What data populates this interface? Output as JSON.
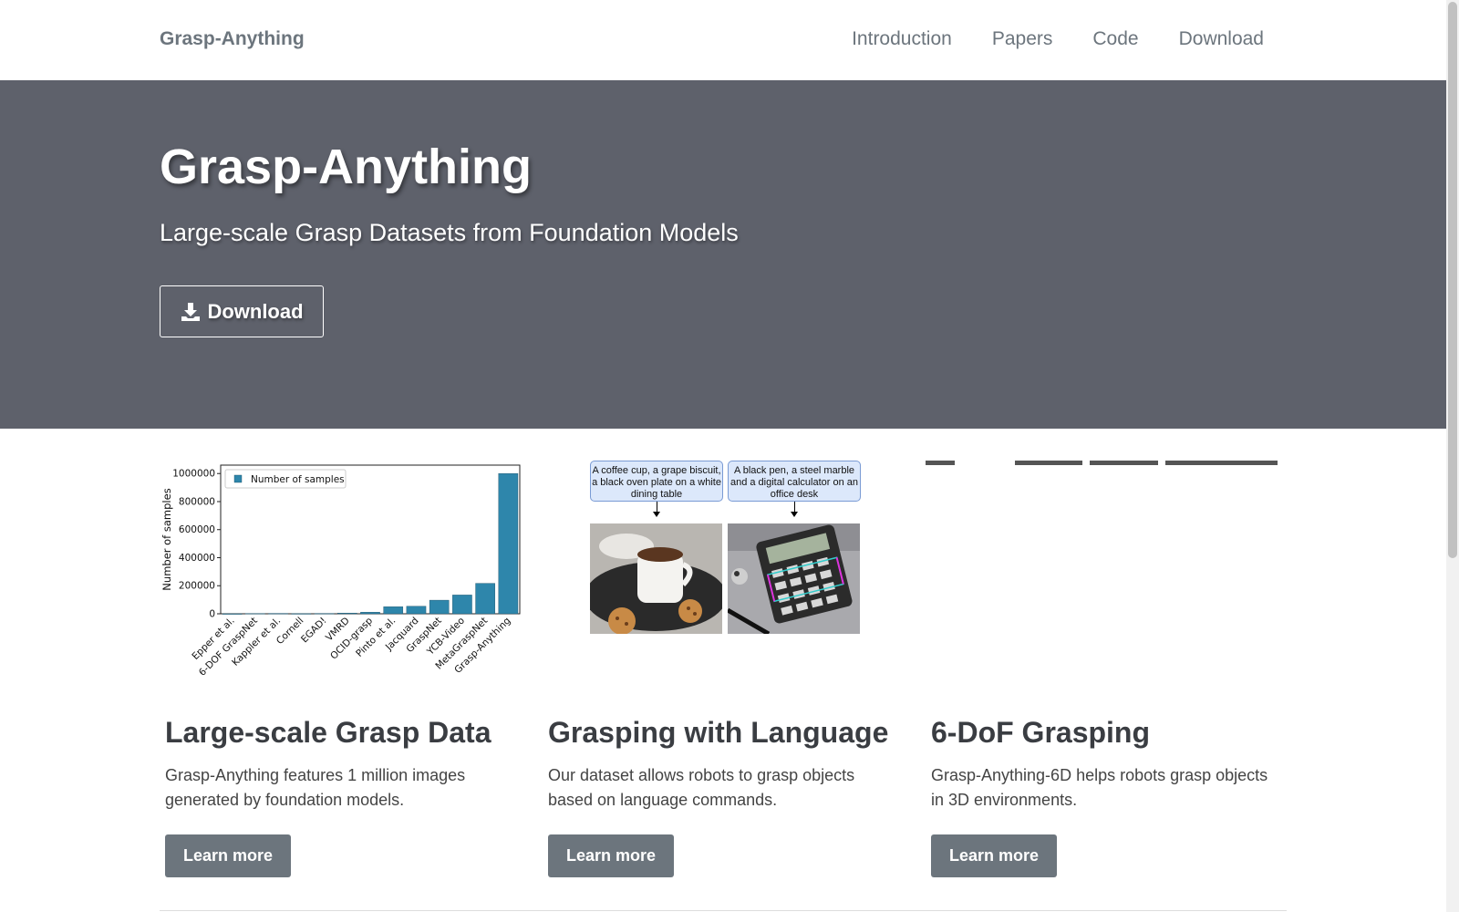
{
  "nav": {
    "brand": "Grasp-Anything",
    "links": [
      "Introduction",
      "Papers",
      "Code",
      "Download"
    ]
  },
  "hero": {
    "title": "Grasp-Anything",
    "subtitle": "Large-scale Grasp Datasets from Foundation Models",
    "download_label": "Download",
    "download_icon": "download-icon"
  },
  "features": [
    {
      "title": "Large-scale Grasp Data",
      "text": "Grasp-Anything features 1 million images generated by foundation models.",
      "button": "Learn more"
    },
    {
      "title": "Grasping with Language",
      "text": "Our dataset allows robots to grasp objects based on language commands.",
      "button": "Learn more"
    },
    {
      "title": "6-DoF Grasping",
      "text": "Grasp-Anything-6D helps robots grasp objects in 3D environments.",
      "button": "Learn more"
    }
  ],
  "language_figure": {
    "captions": [
      "A coffee cup, a grape biscuit, a black oven plate on a white dining table",
      "A black pen, a steel marble and a digital calculator on an office desk"
    ]
  },
  "chart_data": {
    "type": "bar",
    "categories": [
      "Epper et al.",
      "6-DOF GraspNet",
      "Kappler et al.",
      "Cornell",
      "EGAD!",
      "VMRD",
      "OCID-grasp",
      "Pinto et al.",
      "Jacquard",
      "GraspNet",
      "YCB-Video",
      "MetaGraspNet",
      "Grasp-Anything"
    ],
    "series": [
      {
        "name": "Number of samples",
        "values": [
          200,
          2000,
          2500,
          1035,
          2300,
          4700,
          11000,
          50000,
          54000,
          97000,
          134000,
          217000,
          1000000
        ]
      }
    ],
    "ylabel": "Number of samples",
    "yticks": [
      0,
      200000,
      400000,
      600000,
      800000,
      1000000
    ],
    "ylim": [
      0,
      1060000
    ],
    "legend_position": "top-left",
    "bar_color": "#2e86ab",
    "grid": false
  }
}
